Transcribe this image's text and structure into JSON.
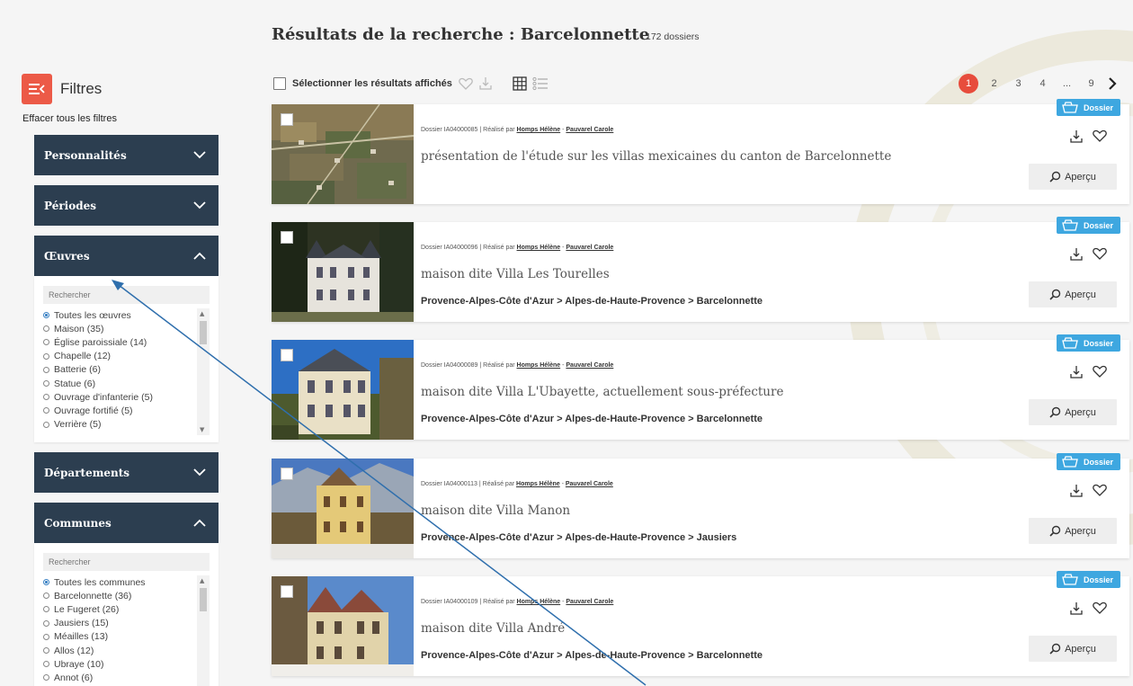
{
  "search": {
    "title": "Résultats de la recherche : Barcelonnette",
    "count": "172 dossiers"
  },
  "sidebar": {
    "filters_label": "Filtres",
    "clear_all": "Effacer tous les filtres",
    "facets": [
      {
        "label": "Personnalités",
        "state": "collapsed"
      },
      {
        "label": "Périodes",
        "state": "collapsed"
      },
      {
        "label": "Œuvres",
        "state": "expanded"
      },
      {
        "label": "Départements",
        "state": "collapsed"
      },
      {
        "label": "Communes",
        "state": "expanded"
      }
    ],
    "oeuvres": {
      "search_placeholder": "Rechercher",
      "options": [
        "Toutes les œuvres",
        "Maison (35)",
        "Église paroissiale (14)",
        "Chapelle (12)",
        "Batterie (6)",
        "Statue (6)",
        "Ouvrage d'infanterie (5)",
        "Ouvrage fortifié (5)",
        "Verrière (5)"
      ],
      "selected": "Toutes les œuvres"
    },
    "communes": {
      "search_placeholder": "Rechercher",
      "options": [
        "Toutes les communes",
        "Barcelonnette (36)",
        "Le Fugeret (26)",
        "Jausiers (15)",
        "Méailles (13)",
        "Allos (12)",
        "Ubraye (10)",
        "Annot (6)"
      ],
      "selected": "Toutes les communes"
    }
  },
  "toolbar": {
    "select_label": "Sélectionner les résultats affichés",
    "icons": [
      "heart-icon",
      "download-icon",
      "grid-view-icon",
      "list-view-icon"
    ]
  },
  "pagination": {
    "current": "1",
    "pages": [
      "2",
      "3",
      "4"
    ],
    "ellipsis": "...",
    "last": "9",
    "next_icon": "chevron-right-icon"
  },
  "card_common": {
    "badge": "Dossier",
    "preview_label": "Aperçu",
    "by_label": "Réalisé par",
    "authors": [
      "Homps Hélène",
      "Pauvarel Carole"
    ]
  },
  "results": [
    {
      "ref": "Dossier IA04000085",
      "title": "présentation de l'étude sur les villas mexicaines du canton de Barcelonnette",
      "location": ""
    },
    {
      "ref": "Dossier IA04000096",
      "title": "maison dite Villa Les Tourelles",
      "location": "Provence-Alpes-Côte d'Azur > Alpes-de-Haute-Provence > Barcelonnette"
    },
    {
      "ref": "Dossier IA04000089",
      "title": "maison dite Villa L'Ubayette, actuellement sous-préfecture",
      "location": "Provence-Alpes-Côte d'Azur > Alpes-de-Haute-Provence > Barcelonnette"
    },
    {
      "ref": "Dossier IA04000113",
      "title": "maison dite Villa Manon",
      "location": "Provence-Alpes-Côte d'Azur > Alpes-de-Haute-Provence > Jausiers"
    },
    {
      "ref": "Dossier IA04000109",
      "title": "maison dite Villa André",
      "location": "Provence-Alpes-Côte d'Azur > Alpes-de-Haute-Provence > Barcelonnette"
    }
  ],
  "colors": {
    "navy": "#2c3e50",
    "accent": "#ec5a47",
    "badge": "#3ea7e0",
    "arrow": "#2f6fad"
  }
}
